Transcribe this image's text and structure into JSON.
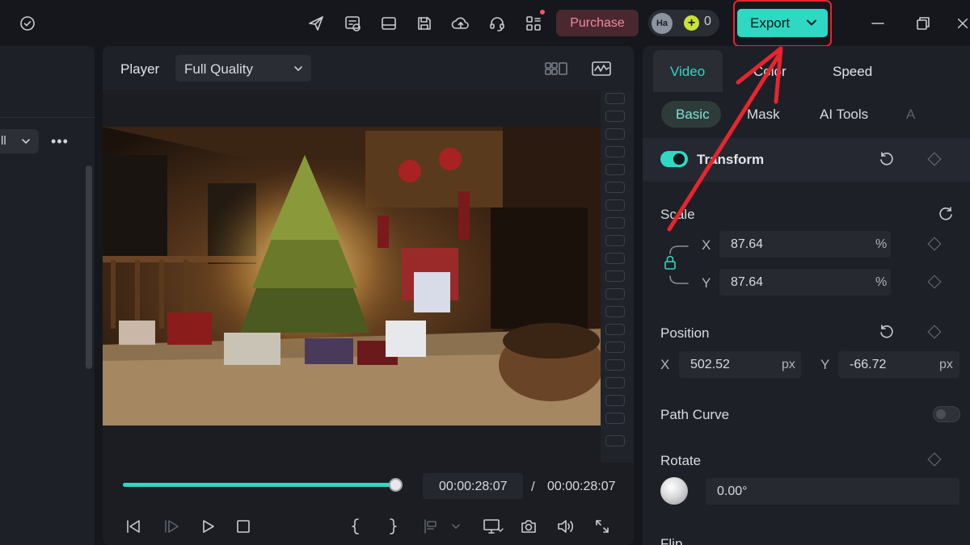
{
  "topbar": {
    "purchase_label": "Purchase",
    "avatar_initials": "Ha",
    "credit_symbol": "+",
    "credit_count": "0",
    "export_label": "Export"
  },
  "left_panel": {
    "filter_value": "ll",
    "more_label": "•••"
  },
  "player": {
    "label": "Player",
    "quality": "Full Quality",
    "progress_fraction": 1.0,
    "time_current": "00:00:28:07",
    "time_separator": "/",
    "time_total": "00:00:28:07"
  },
  "inspector": {
    "tabs": [
      {
        "label": "Video"
      },
      {
        "label": "Color"
      },
      {
        "label": "Speed"
      }
    ],
    "subtabs": [
      {
        "label": "Basic"
      },
      {
        "label": "Mask"
      },
      {
        "label": "AI Tools"
      },
      {
        "label": "A"
      }
    ],
    "transform": {
      "title": "Transform",
      "enabled": true
    },
    "scale": {
      "label": "Scale",
      "x_label": "X",
      "x_value": "87.64",
      "x_unit": "%",
      "y_label": "Y",
      "y_value": "87.64",
      "y_unit": "%"
    },
    "position": {
      "label": "Position",
      "x_label": "X",
      "x_value": "502.52",
      "x_unit": "px",
      "y_label": "Y",
      "y_value": "-66.72",
      "y_unit": "px"
    },
    "path_curve": {
      "label": "Path Curve",
      "enabled": false
    },
    "rotate": {
      "label": "Rotate",
      "value": "0.00°"
    },
    "flip": {
      "label": "Flip"
    }
  },
  "colors": {
    "accent": "#2fd8c2",
    "purchase_text": "#f08aa0",
    "highlight": "#e8252e",
    "panel": "#1d2026"
  }
}
